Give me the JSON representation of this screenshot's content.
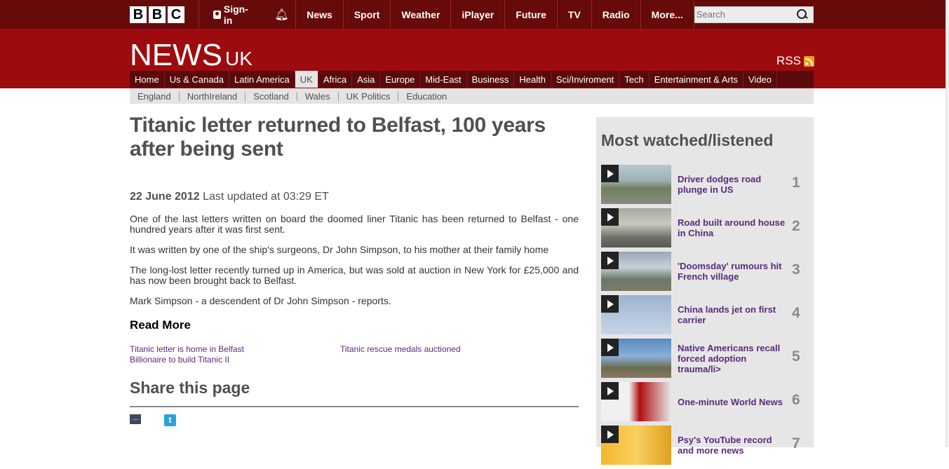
{
  "top": {
    "logo": [
      "B",
      "B",
      "C"
    ],
    "signin": "Sign-in",
    "nav": [
      "News",
      "Sport",
      "Weather",
      "iPlayer",
      "Future",
      "TV",
      "Radio",
      "More..."
    ],
    "search_placeholder": "Search"
  },
  "masthead": {
    "news": "NEWS",
    "edition": "UK",
    "rss": "RSS"
  },
  "main_nav": [
    {
      "label": "Home",
      "active": false
    },
    {
      "label": "Us & Canada",
      "active": false
    },
    {
      "label": "Latin America",
      "active": false
    },
    {
      "label": "UK",
      "active": true
    },
    {
      "label": "Africa",
      "active": false
    },
    {
      "label": "Asia",
      "active": false
    },
    {
      "label": "Europe",
      "active": false
    },
    {
      "label": "Mid-East",
      "active": false
    },
    {
      "label": "Business",
      "active": false
    },
    {
      "label": "Health",
      "active": false
    },
    {
      "label": "Sci/Inviroment",
      "active": false
    },
    {
      "label": "Tech",
      "active": false
    },
    {
      "label": "Entertainment & Arts",
      "active": false
    },
    {
      "label": "Video",
      "active": false
    }
  ],
  "sub_nav": [
    "England",
    "NorthIreland",
    "Scotland",
    "Wales",
    "UK Politics",
    "Education"
  ],
  "article": {
    "headline": "Titanic letter returned to Belfast, 100 years after being sent",
    "date": "22 June 2012",
    "updated": "Last updated at 03:29 ET",
    "paragraphs": [
      "One of the last letters written on board the doomed liner Titanic has been returned to Belfast - one hundred years after it was first sent.",
      "It was written by one of the ship's surgeons, Dr John Simpson, to his mother at their family home",
      "The long-lost letter recently turned up in America, but was sold at auction in New York for £25,000 and has now been brought back to Belfast.",
      "Mark Simpson - a descendent of Dr John Simpson - reports."
    ],
    "read_more": "Read More",
    "related": [
      "Titanic letter is home in Belfast",
      "Titanic rescue medals auctioned",
      "Billionaire to build Titanic II"
    ],
    "share_title": "Share this page",
    "share_icons": [
      "email-icon",
      "twitter-icon"
    ]
  },
  "sidebar": {
    "title": "Most watched/listened",
    "items": [
      {
        "title": "Driver dodges road plunge in US",
        "rank": "1"
      },
      {
        "title": "Road built around house in China",
        "rank": "2"
      },
      {
        "title": "'Doomsday' rumours hit French village",
        "rank": "3"
      },
      {
        "title": "China lands jet on first carrier",
        "rank": "4"
      },
      {
        "title": "Native Americans recall forced adoption trauma/li>",
        "rank": "5"
      },
      {
        "title": "One-minute World News",
        "rank": "6"
      },
      {
        "title": "Psy's YouTube record and more news",
        "rank": "7"
      }
    ]
  },
  "colors": {
    "topbar": "#660a0a",
    "masthead": "#9e0b0f",
    "link_purple": "#5a2a7a"
  }
}
